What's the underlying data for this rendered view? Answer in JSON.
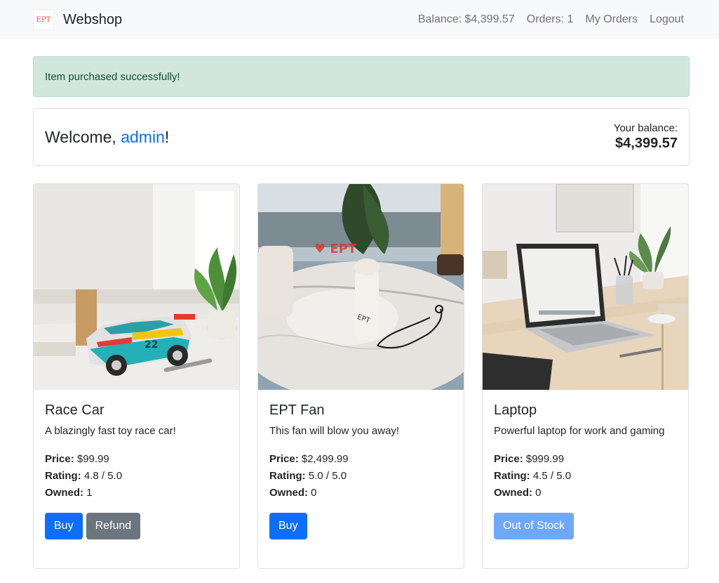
{
  "navbar": {
    "brand_name": "Webshop",
    "logo_text": "EPT",
    "balance": "Balance: $4,399.57",
    "orders": "Orders: 1",
    "my_orders": "My Orders",
    "logout": "Logout"
  },
  "alert": {
    "message": "Item purchased successfully!"
  },
  "welcome": {
    "prefix": "Welcome, ",
    "username": "admin",
    "suffix": "!",
    "balance_label": "Your balance:",
    "balance_value": "$4,399.57"
  },
  "labels": {
    "price": "Price:",
    "rating": "Rating:",
    "owned": "Owned:"
  },
  "products": [
    {
      "name": "Race Car",
      "description": "A blazingly fast toy race car!",
      "price": "$99.99",
      "rating": "4.8 / 5.0",
      "owned": "1",
      "buy_label": "Buy",
      "refund_label": "Refund",
      "car_number": "22"
    },
    {
      "name": "EPT Fan",
      "description": "This fan will blow you away!",
      "price": "$2,499.99",
      "rating": "5.0 / 5.0",
      "owned": "0",
      "buy_label": "Buy",
      "fan_text": "EPT",
      "led_text": "♥ EPT"
    },
    {
      "name": "Laptop",
      "description": "Powerful laptop for work and gaming",
      "price": "$999.99",
      "rating": "4.5 / 5.0",
      "owned": "0",
      "out_of_stock_label": "Out of Stock"
    }
  ],
  "colors": {
    "primary": "#0d6efd",
    "secondary": "#6c757d",
    "success_bg": "#d1e7dd",
    "success_text": "#0f5132"
  }
}
